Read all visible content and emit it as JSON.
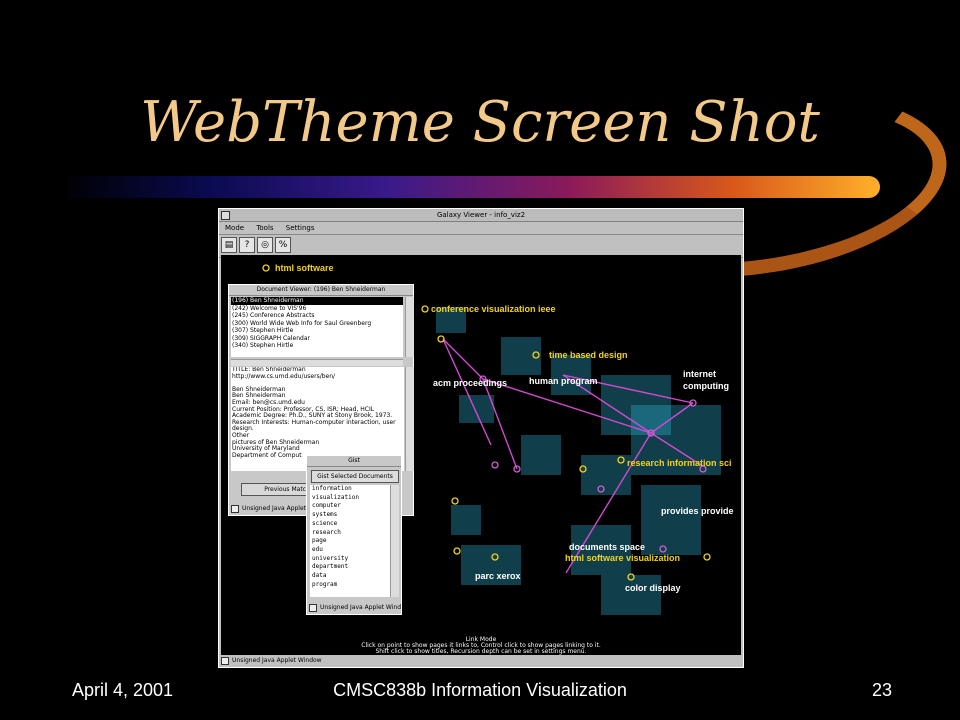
{
  "slide": {
    "title": "WebTheme Screen Shot",
    "footer_left": "April 4, 2001",
    "footer_center": "CMSC838b Information Visualization",
    "footer_right": "23"
  },
  "window": {
    "title": "Galaxy Viewer - info_viz2",
    "menu": [
      "Mode",
      "Tools",
      "Settings"
    ],
    "tools": [
      "▤",
      "?",
      "◎",
      "%"
    ],
    "status_lines": [
      "Link Mode",
      "Click on point to show pages it links to, Control click to show pages linking to it.",
      "Shift click to show titles, Recursion depth can be set in settings menu."
    ],
    "footer": "Unsigned Java Applet Window"
  },
  "galaxy_labels": {
    "html_software": "html software",
    "conference": "conference visualization ieee",
    "time_based": "time based design",
    "internet": "internet",
    "computing": "computing",
    "acm": "acm proceedings",
    "human": "human program",
    "research": "research information sci",
    "provides": "provides provide",
    "documents": "documents space",
    "html_vis": "html software visualization",
    "parc": "parc xerox",
    "color": "color display"
  },
  "doc_viewer": {
    "title": "Document Viewer: (196) Ben Shneiderman",
    "list": [
      "(196) Ben Shneiderman",
      "(242) Welcome to VIS'96",
      "(245) Conference Abstracts",
      "(300) World Wide Web Info for Saul Greenberg",
      "(307) Stephen Hirtle",
      "(309) SIGGRAPH Calendar",
      "(340) Stephen Hirtle"
    ],
    "text": [
      "TITLE: Ben Shneiderman",
      "http://www.cs.umd.edu/users/ben/",
      "",
      "Ben Shneiderman",
      "Ben Shneiderman",
      "Email: ben@cs.umd.edu",
      "Current Position: Professor, CS, ISR; Head, HCIL",
      "Academic Degree: Ph.D., SUNY at Stony Brook, 1973.",
      "Research Interests: Human-computer interaction, user",
      "design.",
      "Other",
      "pictures of Ben Shneiderman",
      "University of Maryland",
      "Department of Comput"
    ],
    "button": "Previous Match",
    "footer": "Unsigned Java Applet W"
  },
  "gist": {
    "title": "Gist",
    "button": "Gist Selected Documents",
    "words": [
      "information",
      "visualization",
      "computer",
      "systems",
      "science",
      "research",
      "page",
      "edu",
      "university",
      "department",
      "data",
      "program"
    ],
    "footer": "Unsigned Java Applet Wind"
  },
  "colors": {
    "title": "#f3c98a",
    "node_yellow": "#f2d21a",
    "link_magenta": "#d04ad0",
    "glow_cyan": "#2fb5d6"
  }
}
